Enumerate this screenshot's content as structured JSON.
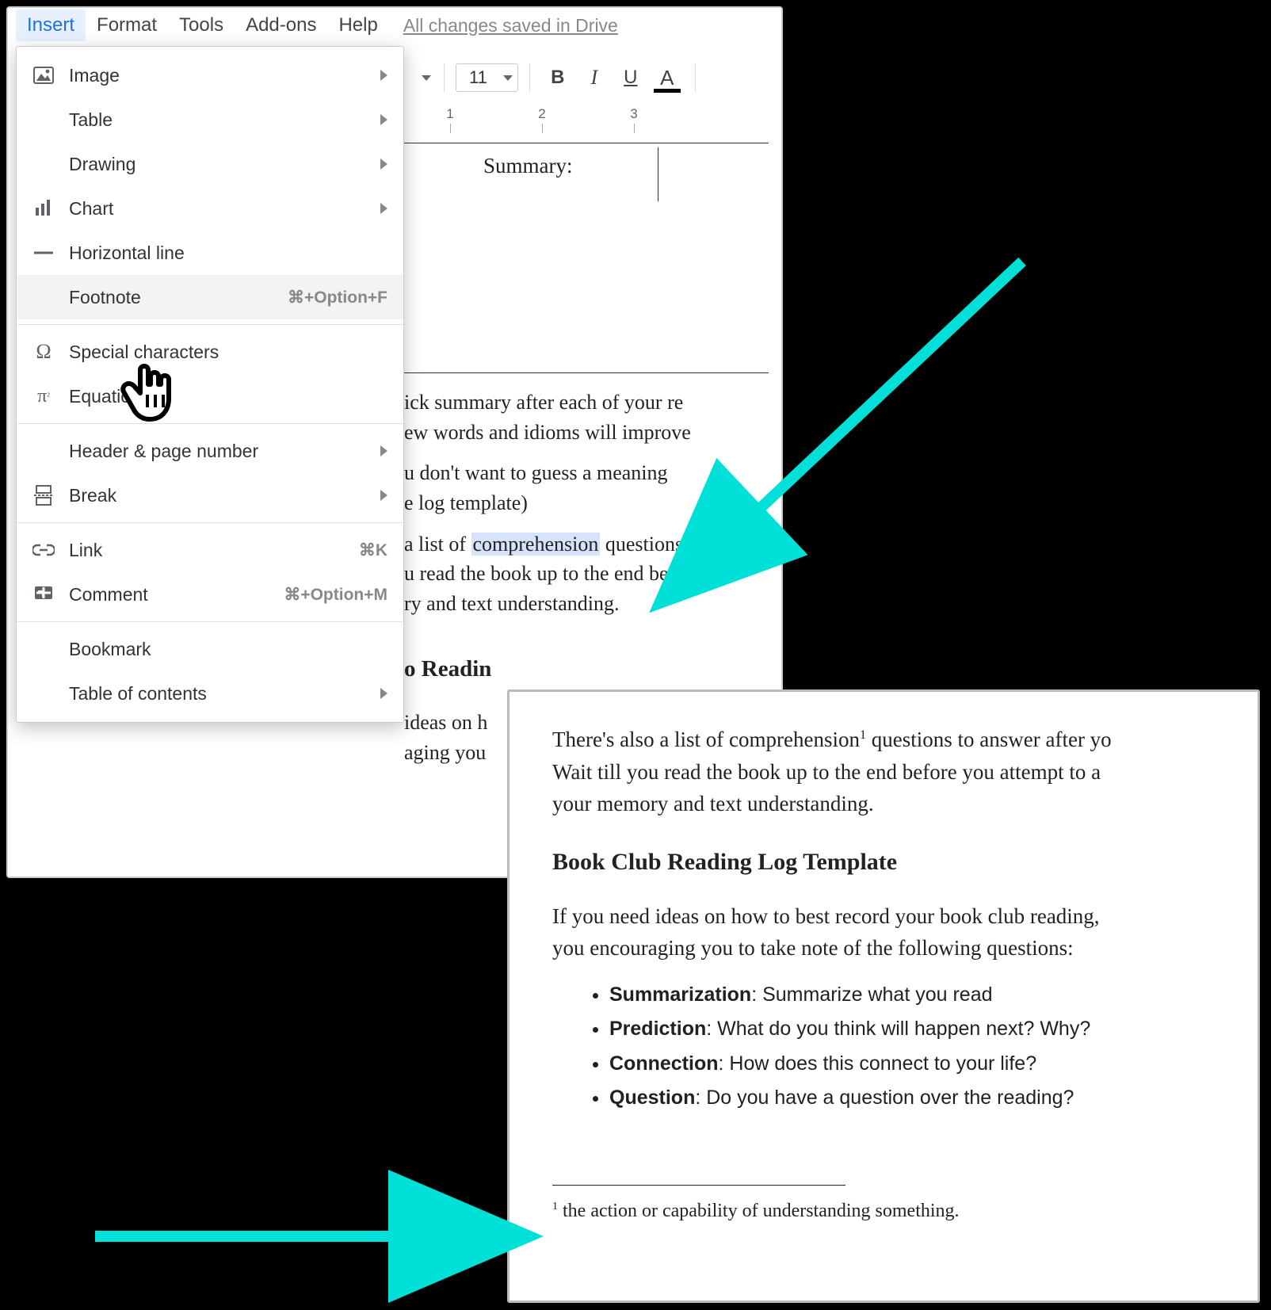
{
  "menubar": {
    "insert": "Insert",
    "format": "Format",
    "tools": "Tools",
    "addons": "Add-ons",
    "help": "Help",
    "saved": "All changes saved in Drive"
  },
  "toolbar": {
    "font_size": "11"
  },
  "ruler": {
    "m1": "1",
    "m2": "2",
    "m3": "3"
  },
  "insert_menu": {
    "image": "Image",
    "table": "Table",
    "drawing": "Drawing",
    "chart": "Chart",
    "hline": "Horizontal line",
    "footnote": "Footnote",
    "footnote_shortcut": "⌘+Option+F",
    "special": "Special characters",
    "equation": "Equation",
    "header": "Header & page number",
    "break": "Break",
    "link": "Link",
    "link_shortcut": "⌘K",
    "comment": "Comment",
    "comment_shortcut": "⌘+Option+M",
    "bookmark": "Bookmark",
    "toc": "Table of contents"
  },
  "doc1": {
    "summary_label": "Summary:",
    "p1a": "ick summary after each of your re",
    "p1b": "ew words and idioms will improve",
    "p2a": "u don't want to guess a meaning ",
    "p2b": "e log template)",
    "p3a_pre": " a list of ",
    "p3a_hl": "comprehension",
    "p3a_post": " questions",
    "p3b": "u read the book up to the end befo",
    "p3c": "ry and text understanding.",
    "h1": "o Readin",
    "p4a": "ideas on h",
    "p4b": "aging you"
  },
  "doc2": {
    "p1a": "There's also a list of comprehension",
    "p1sup": "1",
    "p1b": " questions to answer after yo",
    "p1c": "Wait till you read the book up to the end before you attempt to a",
    "p1d": "your memory and text understanding.",
    "h1": "Book Club Reading Log Template",
    "p2a": "If you need ideas on how to best record your book club reading, ",
    "p2b": "you encouraging you to take note of the following questions:",
    "li1b": "Summarization",
    "li1t": ": Summarize what you read",
    "li2b": "Prediction",
    "li2t": ": What do you think will happen next? Why?",
    "li3b": "Connection",
    "li3t": ": How does this connect to your life?",
    "li4b": "Question",
    "li4t": ": Do you have a question over the reading?",
    "fn_sup": "1",
    "fn_text": " the action or capability of understanding something."
  }
}
